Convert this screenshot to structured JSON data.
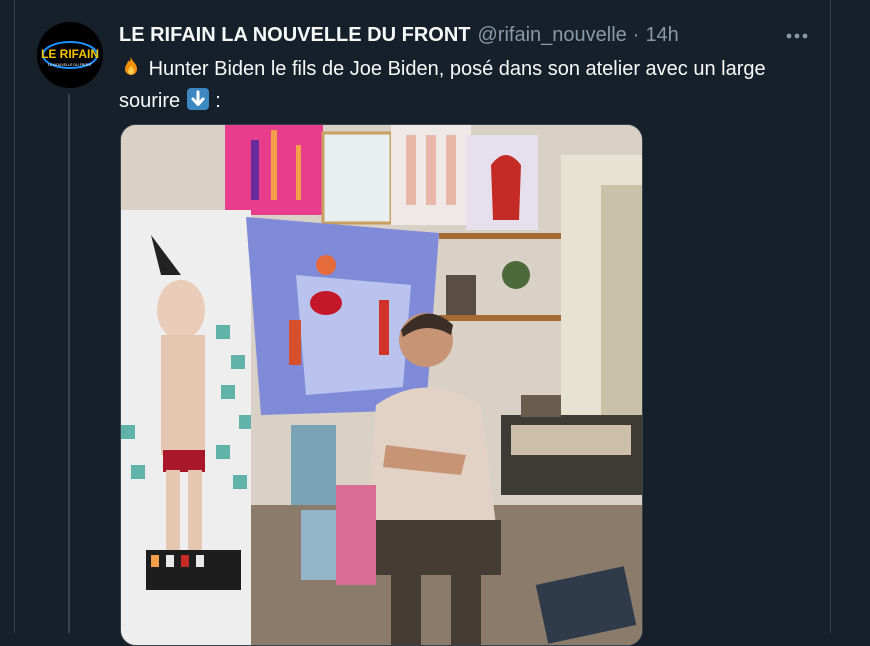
{
  "tweet": {
    "author_name": "LE RIFAIN LA NOUVELLE DU FRONT",
    "handle": "@rifain_nouvelle",
    "separator": "·",
    "time": "14h",
    "text_line1": "Hunter Biden le fils de Joe Biden, posé dans son atelier avec un large",
    "text_line2_before": "sourire",
    "text_line2_after": ":"
  },
  "avatar": {
    "logo_text": "LE RIFAIN",
    "logo_subtext": "LA NOUVELLE DU FRONT"
  },
  "icons": {
    "more": "more-horizontal-icon",
    "fire": "fire-emoji-icon",
    "arrow": "down-arrow-emoji-icon"
  },
  "colors": {
    "background": "#15202b",
    "border": "#38444d",
    "secondary_text": "#8b98a5",
    "primary_text": "#f7f9f9"
  }
}
